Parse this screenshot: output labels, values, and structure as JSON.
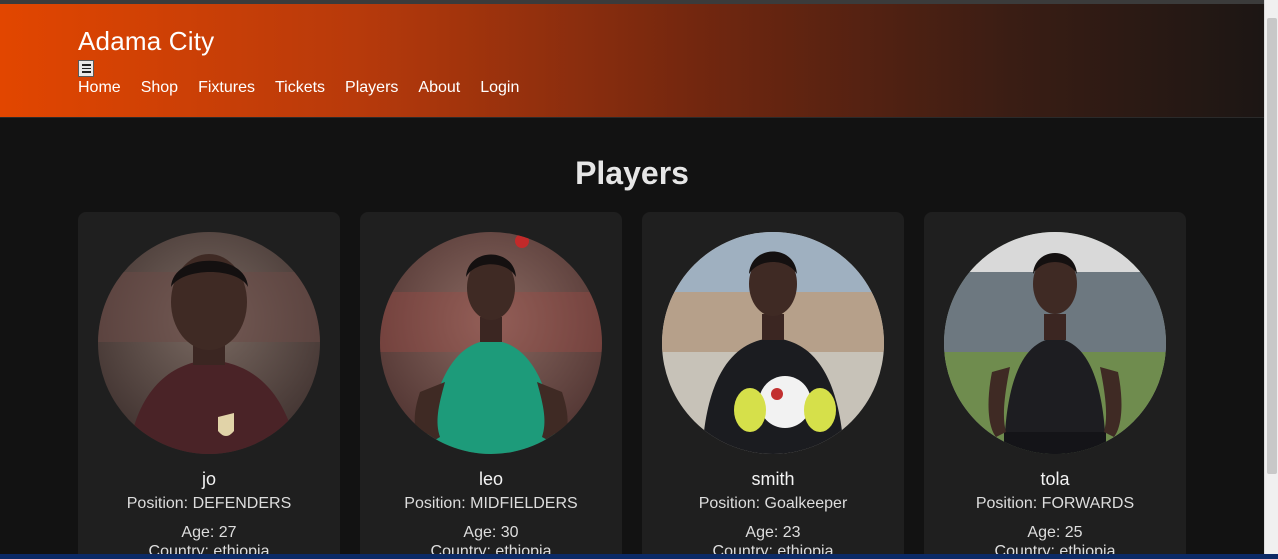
{
  "header": {
    "brand": "Adama City",
    "nav": [
      "Home",
      "Shop",
      "Fixtures",
      "Tickets",
      "Players",
      "About",
      "Login"
    ]
  },
  "page_title": "Players",
  "players": [
    {
      "name": "jo",
      "position": "Position: DEFENDERS",
      "age": "Age: 27",
      "country": "Country: ethiopia",
      "jersey_color": "#4a2327"
    },
    {
      "name": "leo",
      "position": "Position: MIDFIELDERS",
      "age": "Age: 30",
      "country": "Country: ethiopia",
      "jersey_color": "#1d9b7a"
    },
    {
      "name": "smith",
      "position": "Position: Goalkeeper",
      "age": "Age: 23",
      "country": "Country: ethiopia",
      "jersey_color": "#1b1c20"
    },
    {
      "name": "tola",
      "position": "Position: FORWARDS",
      "age": "Age: 25",
      "country": "Country: ethiopia",
      "jersey_color": "#1d1d21"
    }
  ],
  "colors": {
    "header_start": "#e24600",
    "header_end": "#1c1614",
    "background": "#121212",
    "card": "#1f1f1f"
  }
}
